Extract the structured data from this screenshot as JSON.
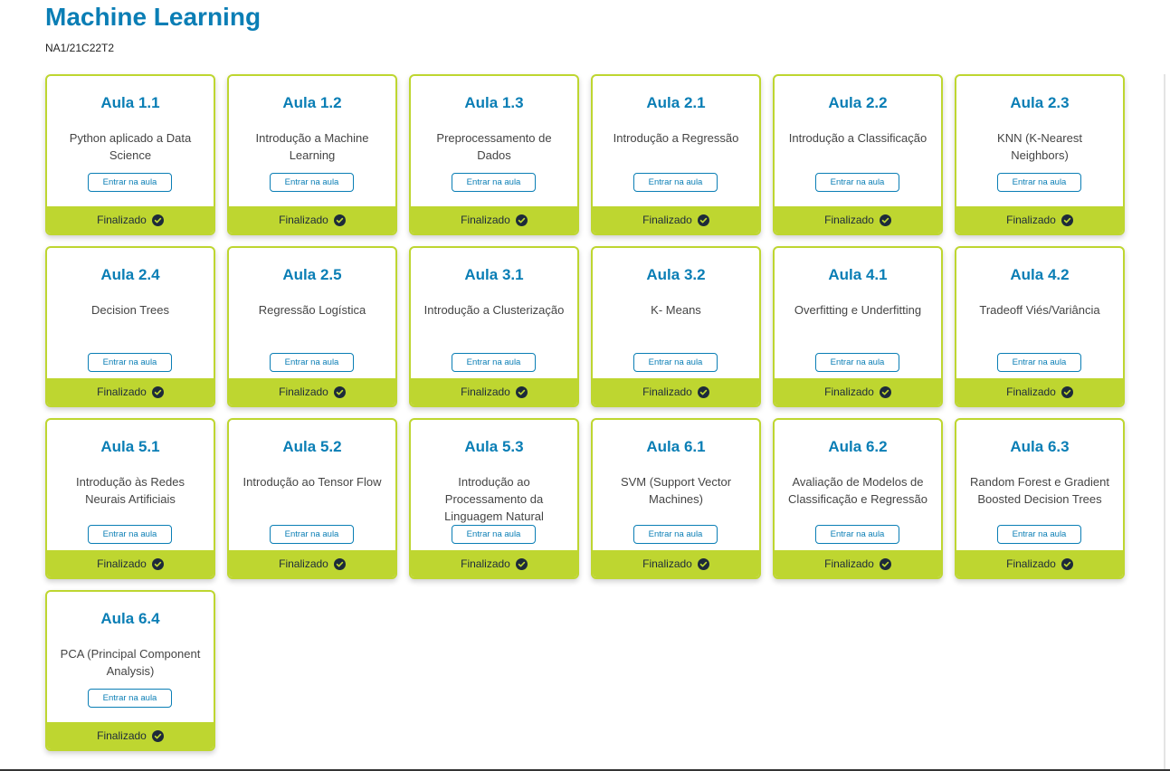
{
  "course": {
    "title": "Machine Learning",
    "code": "NA1/21C22T2"
  },
  "colors": {
    "accent": "#0a7eb5",
    "status_green": "#bed630",
    "check_icon": "#1d2a3a"
  },
  "lessons": [
    {
      "title": "Aula 1.1",
      "description": "Python aplicado a Data Science",
      "button": "Entrar na aula",
      "status": "Finalizado",
      "status_icon": "check-circle-icon"
    },
    {
      "title": "Aula 1.2",
      "description": "Introdução a Machine Learning",
      "button": "Entrar na aula",
      "status": "Finalizado",
      "status_icon": "check-circle-icon"
    },
    {
      "title": "Aula 1.3",
      "description": "Preprocessamento de Dados",
      "button": "Entrar na aula",
      "status": "Finalizado",
      "status_icon": "check-circle-icon"
    },
    {
      "title": "Aula 2.1",
      "description": "Introdução a Regressão",
      "button": "Entrar na aula",
      "status": "Finalizado",
      "status_icon": "check-circle-icon"
    },
    {
      "title": "Aula 2.2",
      "description": "Introdução a Classificação",
      "button": "Entrar na aula",
      "status": "Finalizado",
      "status_icon": "check-circle-icon"
    },
    {
      "title": "Aula 2.3",
      "description": "KNN (K-Nearest Neighbors)",
      "button": "Entrar na aula",
      "status": "Finalizado",
      "status_icon": "check-circle-icon"
    },
    {
      "title": "Aula 2.4",
      "description": "Decision Trees",
      "button": "Entrar na aula",
      "status": "Finalizado",
      "status_icon": "check-circle-icon"
    },
    {
      "title": "Aula 2.5",
      "description": "Regressão Logística",
      "button": "Entrar na aula",
      "status": "Finalizado",
      "status_icon": "check-circle-icon"
    },
    {
      "title": "Aula 3.1",
      "description": "Introdução a Clusterização",
      "button": "Entrar na aula",
      "status": "Finalizado",
      "status_icon": "check-circle-icon"
    },
    {
      "title": "Aula 3.2",
      "description": "K- Means",
      "button": "Entrar na aula",
      "status": "Finalizado",
      "status_icon": "check-circle-icon"
    },
    {
      "title": "Aula 4.1",
      "description": "Overfitting e Underfitting",
      "button": "Entrar na aula",
      "status": "Finalizado",
      "status_icon": "check-circle-icon"
    },
    {
      "title": "Aula 4.2",
      "description": "Tradeoff Viés/Variância",
      "button": "Entrar na aula",
      "status": "Finalizado",
      "status_icon": "check-circle-icon"
    },
    {
      "title": "Aula 5.1",
      "description": "Introdução às Redes Neurais Artificiais",
      "button": "Entrar na aula",
      "status": "Finalizado",
      "status_icon": "check-circle-icon"
    },
    {
      "title": "Aula 5.2",
      "description": "Introdução ao Tensor Flow",
      "button": "Entrar na aula",
      "status": "Finalizado",
      "status_icon": "check-circle-icon"
    },
    {
      "title": "Aula 5.3",
      "description": "Introdução ao Processamento da Linguagem Natural",
      "button": "Entrar na aula",
      "status": "Finalizado",
      "status_icon": "check-circle-icon"
    },
    {
      "title": "Aula 6.1",
      "description": "SVM (Support Vector Machines)",
      "button": "Entrar na aula",
      "status": "Finalizado",
      "status_icon": "check-circle-icon"
    },
    {
      "title": "Aula 6.2",
      "description": "Avaliação de Modelos de Classificação e Regressão",
      "button": "Entrar na aula",
      "status": "Finalizado",
      "status_icon": "check-circle-icon"
    },
    {
      "title": "Aula 6.3",
      "description": "Random Forest e Gradient Boosted Decision Trees",
      "button": "Entrar na aula",
      "status": "Finalizado",
      "status_icon": "check-circle-icon"
    },
    {
      "title": "Aula 6.4",
      "description": "PCA (Principal Component Analysis)",
      "button": "Entrar na aula",
      "status": "Finalizado",
      "status_icon": "check-circle-icon"
    }
  ]
}
